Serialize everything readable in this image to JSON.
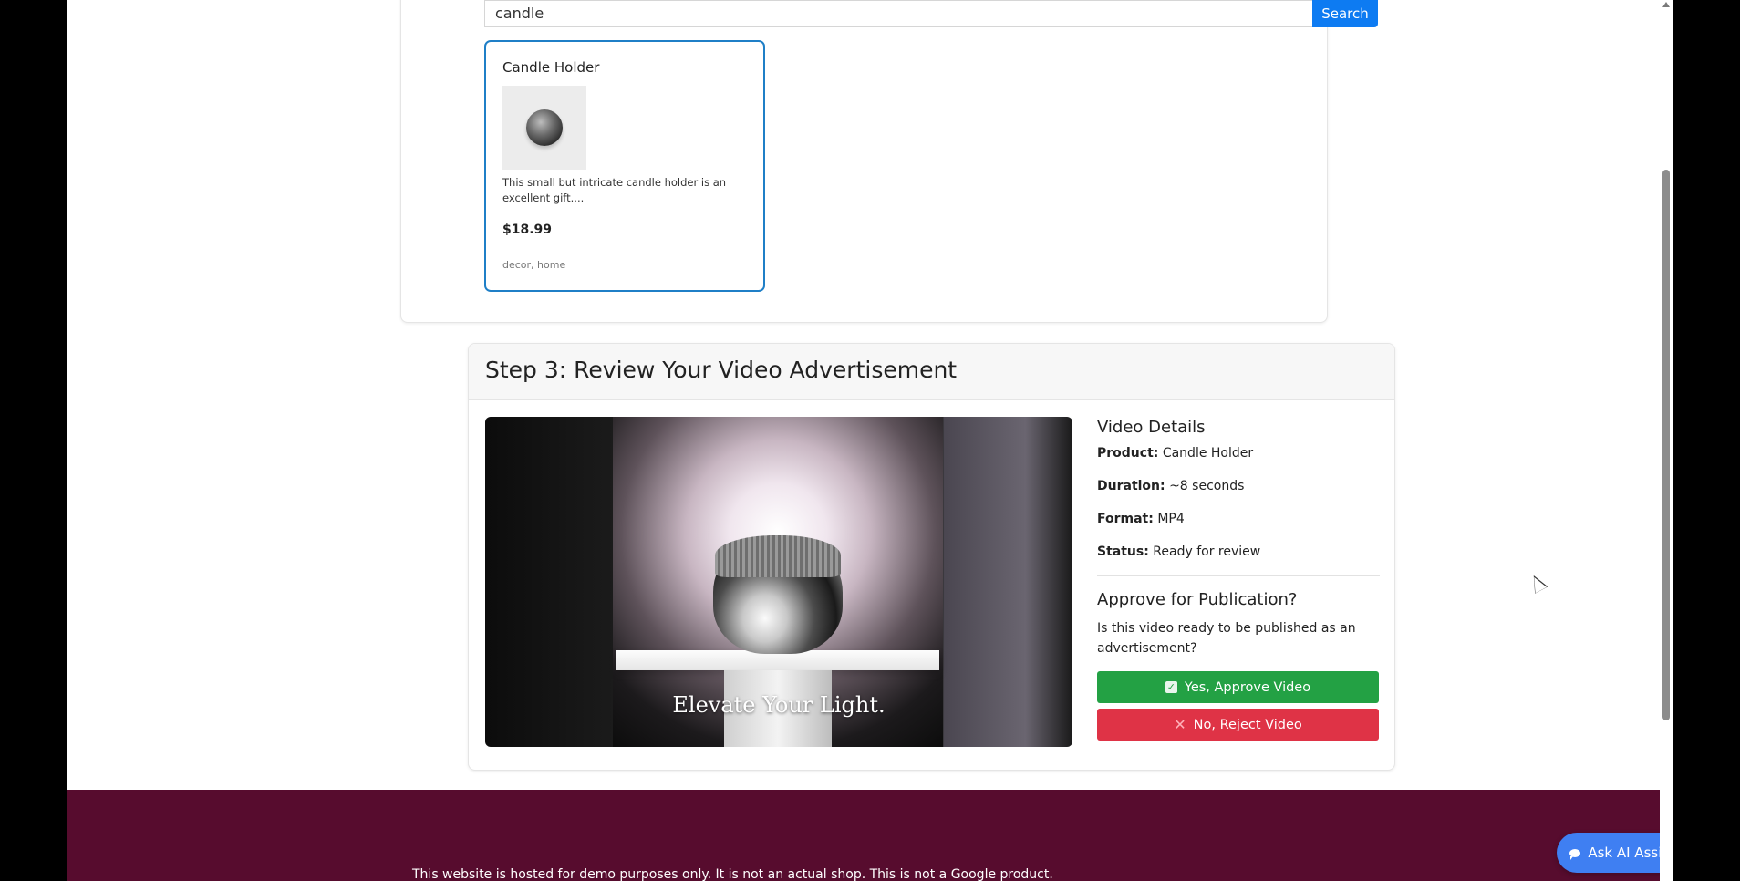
{
  "search": {
    "query": "candle",
    "button_label": "Search"
  },
  "product": {
    "name": "Candle Holder",
    "description": "This small but intricate candle holder is an excellent gift....",
    "price": "$18.99",
    "tags": "decor, home"
  },
  "review": {
    "step_title": "Step 3: Review Your Video Advertisement",
    "video_caption": "Elevate Your Light.",
    "details_title": "Video Details",
    "details": [
      {
        "label": "Product:",
        "value": "Candle Holder"
      },
      {
        "label": "Duration:",
        "value": "~8 seconds"
      },
      {
        "label": "Format:",
        "value": "MP4"
      },
      {
        "label": "Status:",
        "value": "Ready for review"
      }
    ],
    "approve_title": "Approve for Publication?",
    "approve_desc": "Is this video ready to be published as an advertisement?",
    "approve_button": "Yes, Approve Video",
    "reject_button": "No, Reject Video"
  },
  "footer": {
    "disclaimer": "This website is hosted for demo purposes only. It is not an actual shop. This is not a Google product."
  },
  "assistant": {
    "label": "Ask AI Assistant"
  },
  "colors": {
    "primary": "#0d7bf2",
    "approve": "#23a144",
    "reject": "#df3346",
    "footer": "#570c2e",
    "assistant": "#3f7ff2"
  }
}
